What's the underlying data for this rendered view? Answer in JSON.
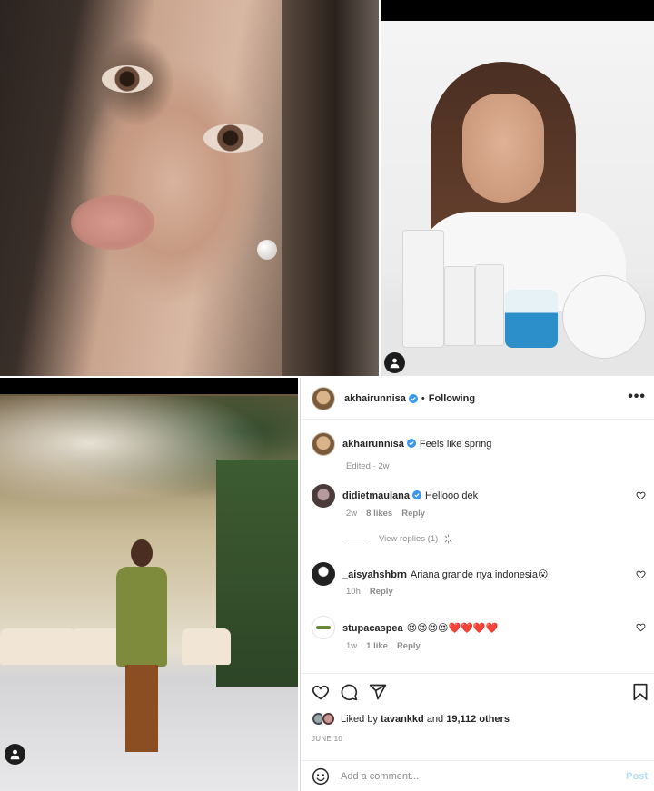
{
  "post": {
    "username": "akhairunnisa",
    "follow_separator": "•",
    "follow_status": "Following",
    "more_label": "•••",
    "caption": "Feels like spring",
    "caption_meta": "Edited · 2w",
    "liked_by_prefix": "Liked by",
    "liked_by_user": "tavankkd",
    "liked_by_and": "and",
    "liked_by_count": "19,112 others",
    "date": "JUNE 10"
  },
  "comments": [
    {
      "username": "didietmaulana",
      "text": "Hellooo dek",
      "time": "2w",
      "likes": "8 likes",
      "reply": "Reply",
      "view_replies": "View replies (1)"
    },
    {
      "username": "_aisyahshbrn",
      "text": "Ariana grande nya indonesia😮",
      "time": "10h",
      "reply": "Reply"
    },
    {
      "username": "stupacaspea",
      "text": "😍😍😍😍❤️❤️❤️❤️",
      "time": "1w",
      "likes": "1 like",
      "reply": "Reply"
    }
  ],
  "comment_box": {
    "placeholder": "Add a comment...",
    "post_label": "Post"
  },
  "icons": [
    "heart-icon",
    "comment-icon",
    "share-icon",
    "bookmark-icon",
    "emoji-icon",
    "user-tag-icon",
    "verified-icon",
    "more-icon"
  ],
  "colors": {
    "verified": "#3897f0",
    "post_button": "#b2dffc",
    "muted": "#8e8e8e"
  }
}
